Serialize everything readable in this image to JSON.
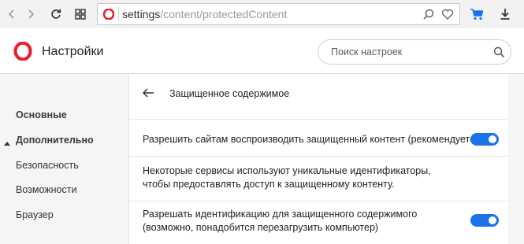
{
  "browser": {
    "url_host": "settings",
    "url_path": "/content/protectedContent",
    "icons": [
      "back-arrow-icon",
      "forward-arrow-icon",
      "reload-icon",
      "tab-grid-icon",
      "opera-logo-icon",
      "search-icon",
      "heart-icon",
      "cart-icon",
      "download-icon"
    ]
  },
  "header": {
    "title": "Настройки",
    "search_placeholder": "Поиск настроек"
  },
  "sidebar": {
    "items": [
      {
        "label": "Основные"
      },
      {
        "label": "Дополнительно"
      },
      {
        "label": "Безопасность"
      },
      {
        "label": "Возможности"
      },
      {
        "label": "Браузер"
      }
    ]
  },
  "main": {
    "subtitle": "Защищенное содержимое",
    "settings": [
      {
        "label": "Разрешить сайтам воспроизводить защищенный контент (рекомендуется)",
        "enabled": true
      },
      {
        "label": "Некоторые сервисы используют уникальные идентификаторы, чтобы предоставлять доступ к защищенному контенту."
      },
      {
        "label": "Разрешать идентификацию для защищенного содержимого (возможно, понадобится перезагрузить компьютер)",
        "enabled": true
      }
    ]
  },
  "colors": {
    "accent": "#1a73e8",
    "opera_red": "#e3232f",
    "cart_blue": "#1a73e8"
  }
}
